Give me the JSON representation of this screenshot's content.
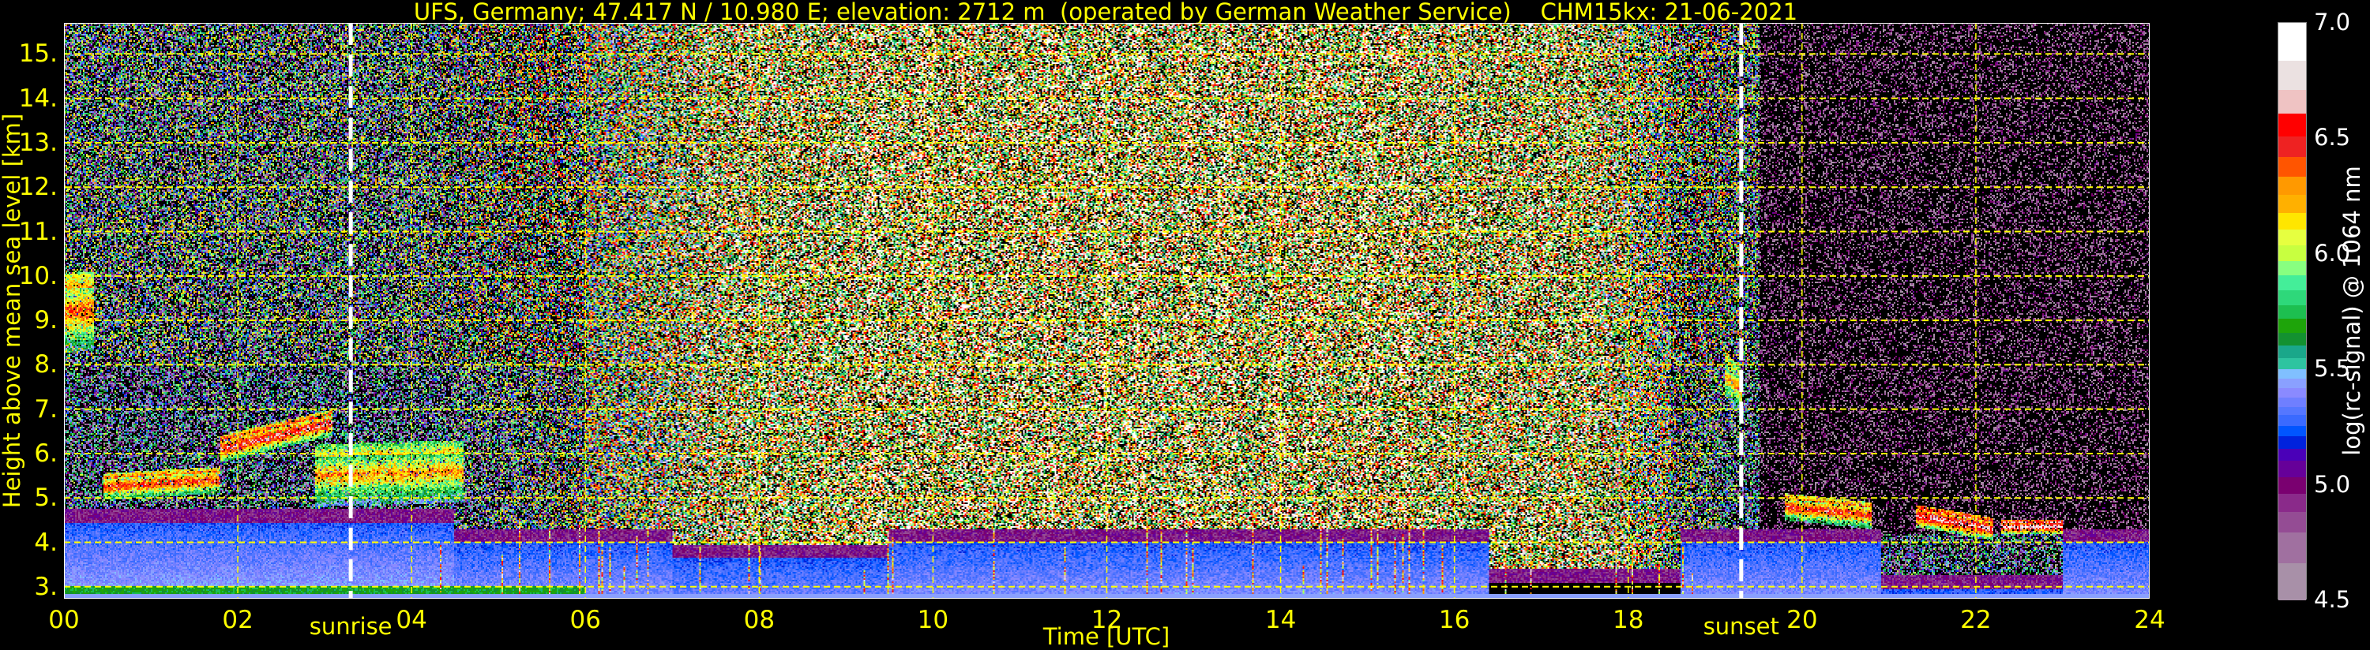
{
  "chart_data": {
    "type": "heatmap",
    "title": "UFS, Germany; 47.417 N / 10.980 E; elevation: 2712 m  (operated by German Weather Service)    CHM15kx: 21-06-2021",
    "xlabel": "Time [UTC]",
    "ylabel": "Height above mean sea level [km]",
    "xlim": [
      0,
      24
    ],
    "ylim": [
      2.73,
      15.7
    ],
    "x_ticks": [
      0,
      2,
      4,
      6,
      8,
      10,
      12,
      14,
      16,
      18,
      20,
      22,
      24
    ],
    "x_tick_labels": [
      "00",
      "02",
      "04",
      "06",
      "08",
      "10",
      "12",
      "14",
      "16",
      "18",
      "20",
      "22",
      "24"
    ],
    "y_ticks": [
      3,
      4,
      5,
      6,
      7,
      8,
      9,
      10,
      11,
      12,
      13,
      14,
      15
    ],
    "y_tick_labels": [
      "3.",
      "4.",
      "5.",
      "6.",
      "7.",
      "8.",
      "9.",
      "10.",
      "11.",
      "12.",
      "13.",
      "14.",
      "15."
    ],
    "grid": true,
    "grid_color": "#ffff00",
    "annotations": [
      {
        "label": "sunrise",
        "time": 3.3
      },
      {
        "label": "sunset",
        "time": 19.3
      }
    ],
    "colorbar": {
      "label": "log(rc-signal) @ 1064 nm",
      "range": [
        4.5,
        7.0
      ],
      "ticks": [
        4.5,
        5.0,
        5.5,
        6.0,
        6.5,
        7.0
      ],
      "tick_labels": [
        "4.5",
        "5.0",
        "5.5",
        "6.0",
        "6.5",
        "7.0"
      ],
      "edges": [
        4.5,
        4.662,
        4.797,
        4.884,
        4.963,
        5.035,
        5.107,
        5.159,
        5.213,
        5.258,
        5.303,
        5.339,
        5.379,
        5.42,
        5.46,
        5.503,
        5.55,
        5.604,
        5.658,
        5.721,
        5.779,
        5.844,
        5.91,
        5.97,
        6.04,
        6.108,
        6.177,
        6.256,
        6.334,
        6.42,
        6.51,
        6.609,
        6.712,
        6.838,
        7.0
      ],
      "colors": [
        "#a890a8",
        "#a070a0",
        "#944c94",
        "#8a2a8a",
        "#7a0070",
        "#660099",
        "#4a00b8",
        "#0022dd",
        "#0055ff",
        "#3a6aff",
        "#5577ff",
        "#6f7fff",
        "#8a8aff",
        "#8aa0ff",
        "#80bfff",
        "#2ec4a0",
        "#1aa78a",
        "#139130",
        "#1ea40a",
        "#1dbf50",
        "#2ed87a",
        "#44ee99",
        "#88ff80",
        "#c8ff40",
        "#e6ff40",
        "#ffe600",
        "#ffb000",
        "#ff9900",
        "#ff5500",
        "#ee2222",
        "#ff0000",
        "#efc3c3",
        "#ebe1e1",
        "#ffffff"
      ]
    },
    "cloud_layers": [
      {
        "t0": 0.0,
        "t1": 0.35,
        "h_start": 9.2,
        "h_end": 9.2,
        "thickness": 0.9,
        "log_signal": 6.4
      },
      {
        "t0": 0.45,
        "t1": 1.8,
        "h_start": 5.25,
        "h_end": 5.4,
        "thickness": 0.3,
        "log_signal": 6.5
      },
      {
        "t0": 1.8,
        "t1": 3.1,
        "h_start": 6.1,
        "h_end": 6.7,
        "thickness": 0.3,
        "log_signal": 6.6
      },
      {
        "t0": 2.9,
        "t1": 4.6,
        "h_start": 5.5,
        "h_end": 5.6,
        "thickness": 0.7,
        "log_signal": 6.3
      },
      {
        "t0": 19.1,
        "t1": 19.3,
        "h_start": 7.8,
        "h_end": 7.4,
        "thickness": 0.5,
        "log_signal": 6.3
      },
      {
        "t0": 19.8,
        "t1": 20.8,
        "h_start": 4.8,
        "h_end": 4.6,
        "thickness": 0.3,
        "log_signal": 6.5
      },
      {
        "t0": 21.3,
        "t1": 22.2,
        "h_start": 4.6,
        "h_end": 4.3,
        "thickness": 0.25,
        "log_signal": 6.7
      },
      {
        "t0": 22.3,
        "t1": 23.0,
        "h_start": 4.35,
        "h_end": 4.35,
        "thickness": 0.15,
        "log_signal": 6.8
      }
    ]
  }
}
